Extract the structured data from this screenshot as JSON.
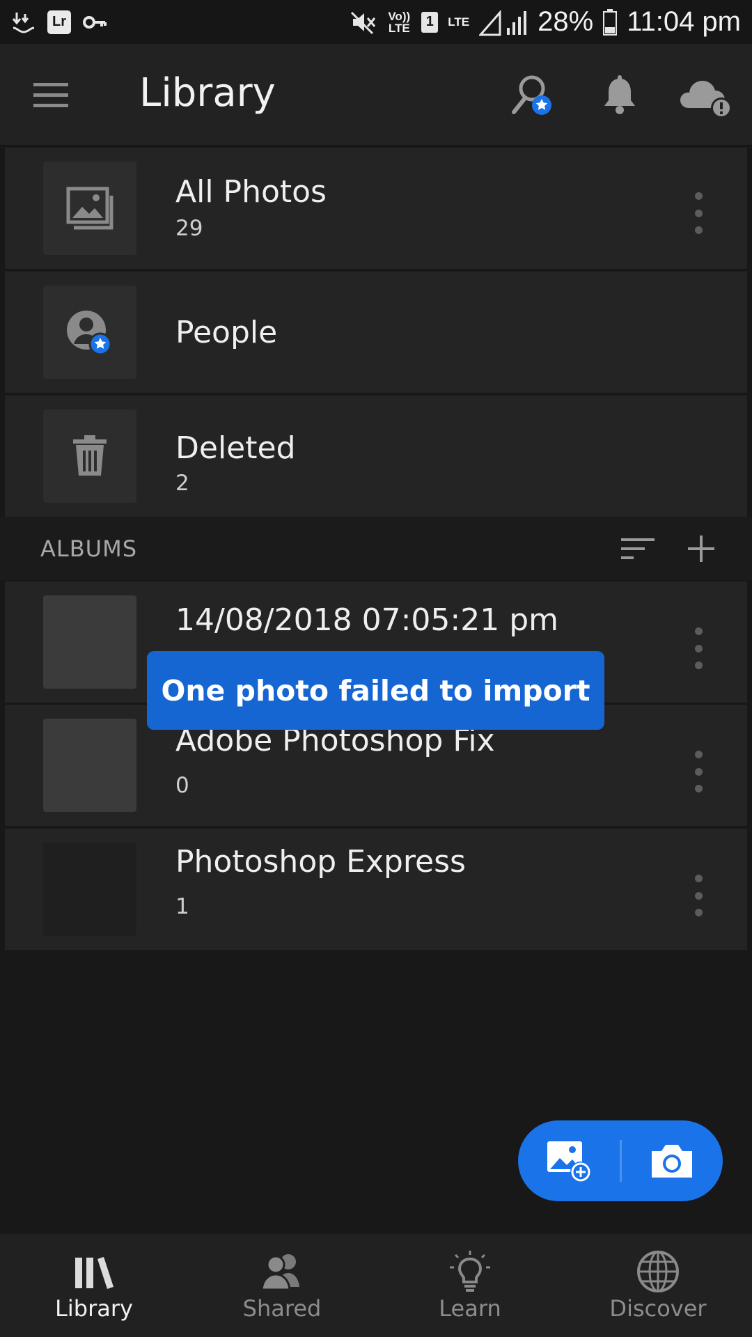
{
  "status_bar": {
    "volte": "Vo)) LTE",
    "sim": "1",
    "lte": "LTE",
    "battery": "28%",
    "time": "11:04 pm",
    "lr_badge": "Lr",
    "icons": [
      "download-icon",
      "lr-app-icon",
      "vpn-key-icon",
      "mute-icon",
      "signal-icon",
      "battery-icon"
    ]
  },
  "app_bar": {
    "title": "Library",
    "icons": [
      "menu-icon",
      "search-people-icon",
      "bell-icon",
      "cloud-alert-icon"
    ]
  },
  "library_items": [
    {
      "title": "All Photos",
      "count": "29",
      "icon": "photos-icon"
    },
    {
      "title": "People",
      "count": "",
      "icon": "person-star-icon"
    },
    {
      "title": "Deleted",
      "count": "2",
      "icon": "trash-icon"
    }
  ],
  "albums": {
    "label": "ALBUMS",
    "items": [
      {
        "title": "14/08/2018 07:05:21 pm",
        "count": ""
      },
      {
        "title": "Adobe Photoshop Fix",
        "count": "0"
      },
      {
        "title": "Photoshop Express",
        "count": "1"
      }
    ]
  },
  "toast": {
    "message": "One photo failed to import"
  },
  "fab": {
    "icons": [
      "add-photo-icon",
      "camera-icon"
    ]
  },
  "bottom_nav": [
    {
      "label": "Library",
      "icon": "library-icon",
      "active": true
    },
    {
      "label": "Shared",
      "icon": "shared-people-icon",
      "active": false
    },
    {
      "label": "Learn",
      "icon": "lightbulb-icon",
      "active": false
    },
    {
      "label": "Discover",
      "icon": "globe-icon",
      "active": false
    }
  ],
  "colors": {
    "accent": "#1a73e8",
    "toast": "#1566d2",
    "background": "#181818",
    "row": "#242424"
  }
}
